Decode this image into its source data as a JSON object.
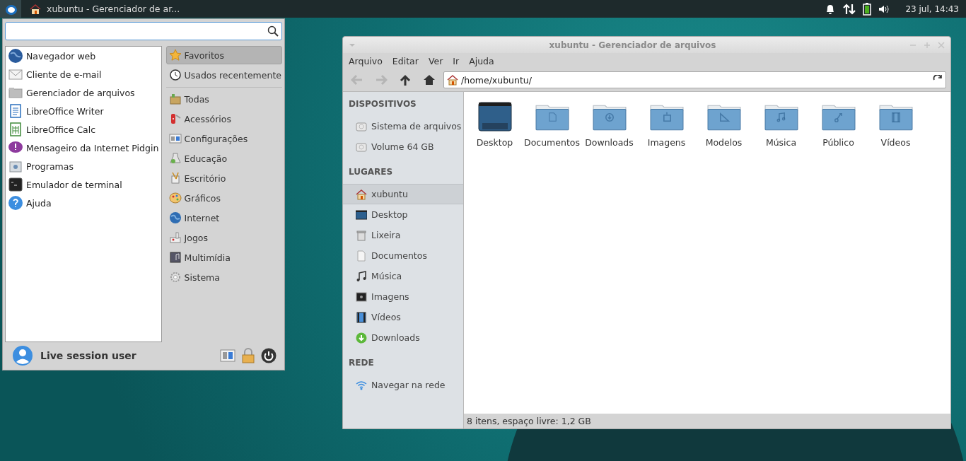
{
  "panel": {
    "task": "xubuntu - Gerenciador de ar...",
    "clock": "23 jul, 14:43"
  },
  "menu": {
    "apps": [
      {
        "label": "Navegador web"
      },
      {
        "label": "Cliente de e-mail"
      },
      {
        "label": "Gerenciador de arquivos"
      },
      {
        "label": "LibreOffice Writer"
      },
      {
        "label": "LibreOffice Calc"
      },
      {
        "label": "Mensageiro da Internet Pidgin"
      },
      {
        "label": "Programas"
      },
      {
        "label": "Emulador de terminal"
      },
      {
        "label": "Ajuda"
      }
    ],
    "categories": [
      {
        "label": "Favoritos",
        "selected": true
      },
      {
        "label": "Usados recentemente",
        "selected": false
      },
      {
        "label": "Todas",
        "selected": false
      },
      {
        "label": "Acessórios",
        "selected": false
      },
      {
        "label": "Configurações",
        "selected": false
      },
      {
        "label": "Educação",
        "selected": false
      },
      {
        "label": "Escritório",
        "selected": false
      },
      {
        "label": "Gráficos",
        "selected": false
      },
      {
        "label": "Internet",
        "selected": false
      },
      {
        "label": "Jogos",
        "selected": false
      },
      {
        "label": "Multimídia",
        "selected": false
      },
      {
        "label": "Sistema",
        "selected": false
      }
    ],
    "user": "Live session user"
  },
  "file_manager": {
    "title": "xubuntu - Gerenciador de arquivos",
    "menu": [
      "Arquivo",
      "Editar",
      "Ver",
      "Ir",
      "Ajuda"
    ],
    "nav": [
      {
        "kind": "back",
        "disabled": true
      },
      {
        "kind": "forward",
        "disabled": true
      },
      {
        "kind": "up",
        "disabled": false
      },
      {
        "kind": "home",
        "disabled": false
      }
    ],
    "location": "/home/xubuntu/",
    "sidebar": [
      {
        "heading": "DISPOSITIVOS",
        "items": [
          {
            "label": "Sistema de arquivos",
            "kind": "drive",
            "selected": false
          },
          {
            "label": "Volume 64 GB",
            "kind": "drive",
            "selected": false
          }
        ]
      },
      {
        "heading": "LUGARES",
        "items": [
          {
            "label": "xubuntu",
            "kind": "home",
            "selected": true
          },
          {
            "label": "Desktop",
            "kind": "desktop",
            "selected": false
          },
          {
            "label": "Lixeira",
            "kind": "trash",
            "selected": false
          },
          {
            "label": "Documentos",
            "kind": "document",
            "selected": false
          },
          {
            "label": "Música",
            "kind": "music",
            "selected": false
          },
          {
            "label": "Imagens",
            "kind": "image",
            "selected": false
          },
          {
            "label": "Vídeos",
            "kind": "video",
            "selected": false
          },
          {
            "label": "Downloads",
            "kind": "download",
            "selected": false
          }
        ]
      },
      {
        "heading": "REDE",
        "items": [
          {
            "label": "Navegar na rede",
            "kind": "network",
            "selected": false
          }
        ]
      }
    ],
    "files": [
      {
        "label": "Desktop",
        "kind": "desktop"
      },
      {
        "label": "Documentos",
        "kind": "document"
      },
      {
        "label": "Downloads",
        "kind": "download"
      },
      {
        "label": "Imagens",
        "kind": "image"
      },
      {
        "label": "Modelos",
        "kind": "template"
      },
      {
        "label": "Música",
        "kind": "music"
      },
      {
        "label": "Público",
        "kind": "share"
      },
      {
        "label": "Vídeos",
        "kind": "video"
      }
    ],
    "status": "8 itens, espaço livre: 1,2 GB"
  }
}
